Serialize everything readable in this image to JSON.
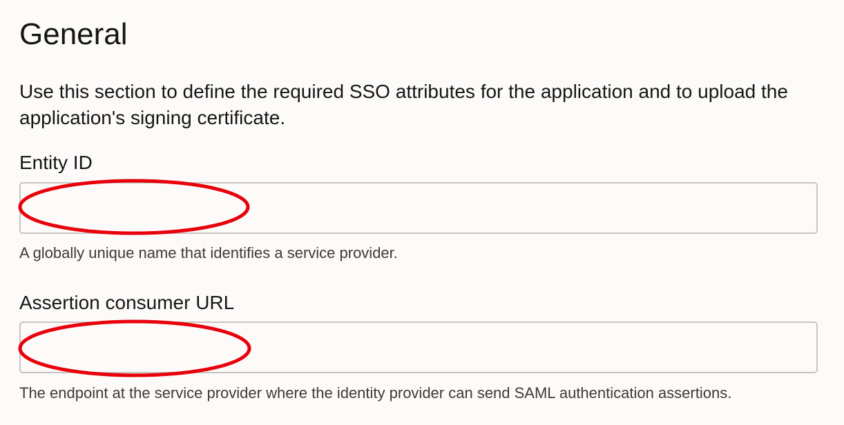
{
  "section": {
    "title": "General",
    "description": "Use this section to define the required SSO attributes for the application and to upload the application's signing certificate."
  },
  "fields": {
    "entity_id": {
      "label": "Entity ID",
      "value": "",
      "help": "A globally unique name that identifies a service provider."
    },
    "assertion_consumer_url": {
      "label": "Assertion consumer URL",
      "value": "",
      "help": "The endpoint at the service provider where the identity provider can send SAML authentication assertions."
    }
  },
  "annotations": {
    "redaction_color": "#e8000b"
  }
}
